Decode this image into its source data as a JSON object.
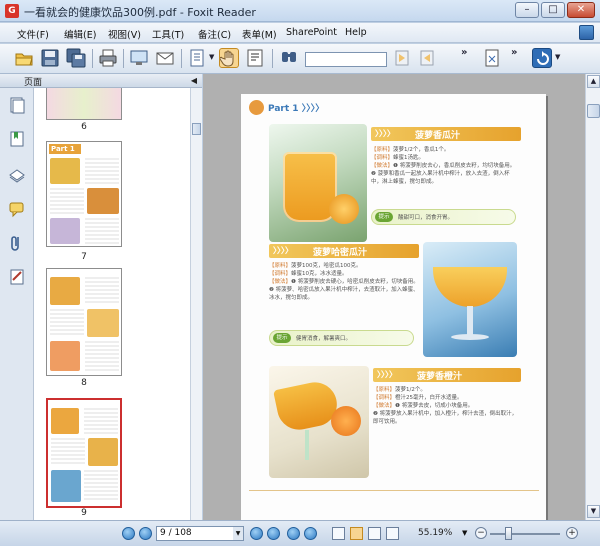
{
  "window": {
    "title": "一看就会的健康饮品300例.pdf - Foxit Reader",
    "minimize": "–",
    "maximize": "□",
    "close": "✕"
  },
  "menu": [
    "文件(F)",
    "编辑(E)",
    "视图(V)",
    "工具(T)",
    "备注(C)",
    "表单(M)",
    "SharePoint",
    "Help"
  ],
  "toolbar": {
    "icons": [
      "open-icon",
      "save-icon",
      "save-as-icon",
      "print-icon",
      "screen-icon",
      "email-icon",
      "select-icon",
      "hand-icon",
      "text-select-icon",
      "find-icon",
      "prev-result-icon",
      "next-result-icon",
      "snapshot-icon",
      "rotate-icon"
    ],
    "more": "»"
  },
  "panel": {
    "title": "页面",
    "collapse": "◀",
    "side_icons": [
      "pages-icon",
      "bookmarks-icon",
      "layers-icon",
      "comments-icon",
      "attachments-icon",
      "signatures-icon"
    ],
    "thumbnails": [
      {
        "num": "6"
      },
      {
        "num": "7",
        "part": "Part 1"
      },
      {
        "num": "8"
      },
      {
        "num": "9",
        "selected": true
      }
    ]
  },
  "document": {
    "part_label": "Part 1",
    "part_arrows": "〉〉〉〉",
    "recipes": [
      {
        "name": "菠萝香瓜汁",
        "lines": [
          {
            "k": "【原料】",
            "v": "菠萝1/2个，香瓜1个。"
          },
          {
            "k": "【调料】",
            "v": "蜂蜜1汤匙。"
          },
          {
            "k": "【做法】",
            "v": "❶ 将菠萝削皮去心，香瓜削皮去籽，均切块备用。"
          },
          {
            "k": "",
            "v": "❷ 菠萝和香瓜一起放入果汁机中榨汁，放入去渣，倒入杯中，淋上蜂蜜，搅匀即成。"
          }
        ],
        "tip_badge": "提示",
        "tip": "酸甜可口，消食开胃。"
      },
      {
        "name": "菠萝哈密瓜汁",
        "lines": [
          {
            "k": "【原料】",
            "v": "菠萝100克，哈密瓜100克。"
          },
          {
            "k": "【调料】",
            "v": "蜂蜜10克，冰水适量。"
          },
          {
            "k": "【做法】",
            "v": "❶ 将菠萝削皮去硬心，哈密瓜削皮去籽，切块备用。"
          },
          {
            "k": "",
            "v": "❷ 将菠萝、哈密瓜放入果汁机中榨汁，去渣取汁，加入蜂蜜、冰水，搅匀即成。"
          }
        ],
        "tip_badge": "提示",
        "tip": "健胃消食，解暑爽口。"
      },
      {
        "name": "菠萝香橙汁",
        "lines": [
          {
            "k": "【原料】",
            "v": "菠萝1/2个。"
          },
          {
            "k": "【调料】",
            "v": "橙汁25毫升，白开水适量。"
          },
          {
            "k": "【做法】",
            "v": "❶ 将菠萝去皮，切成小块备用。"
          },
          {
            "k": "",
            "v": "❷ 将菠萝放入果汁机中，加入橙汁，榨汁去渣，倒出取汁，即可饮用。"
          }
        ]
      }
    ]
  },
  "status": {
    "page_value": "9 / 108",
    "zoom": "55.19%",
    "zoom_level_fraction": 0.26,
    "minus": "−",
    "plus": "+"
  }
}
